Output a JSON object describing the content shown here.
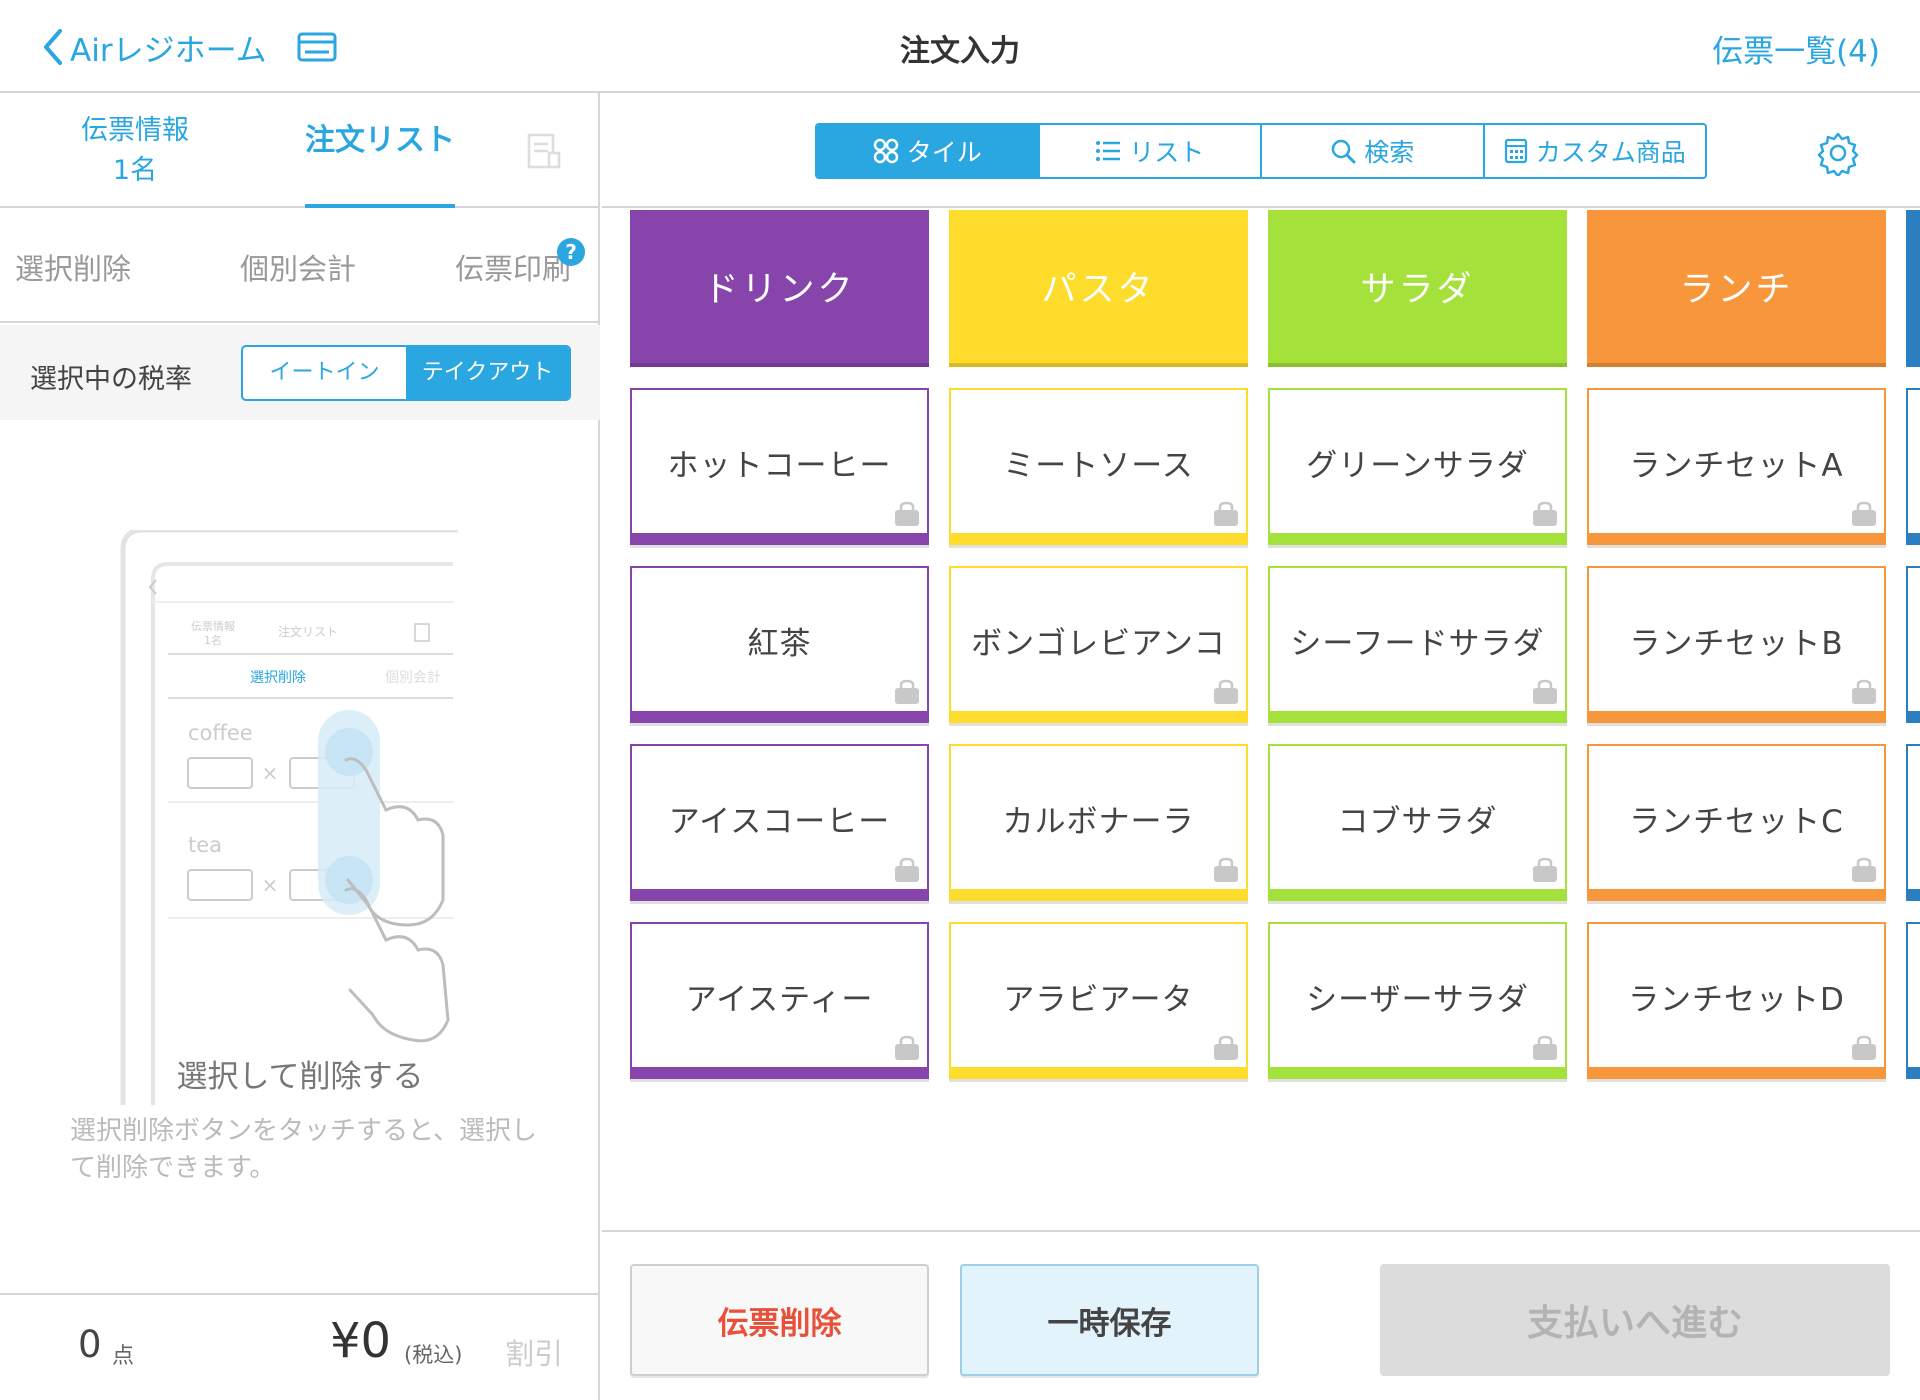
{
  "header": {
    "back_label": "Airレジホーム",
    "title": "注文入力",
    "slip_list_label": "伝票一覧(4)"
  },
  "left_tabs": {
    "info_line1": "伝票情報",
    "info_line2": "1名",
    "order_list": "注文リスト"
  },
  "left_actions": {
    "select_delete": "選択削除",
    "separate_checkout": "個別会計",
    "print_slip": "伝票印刷",
    "help": "?"
  },
  "tax_rate": {
    "label": "選択中の税率",
    "options": [
      "イートイン",
      "テイクアウト"
    ],
    "selected": "テイクアウト"
  },
  "illustration": {
    "tab_info_line1": "伝票情報",
    "tab_info_line2": "1名",
    "tab_order": "注文リスト",
    "action_delete": "選択削除",
    "action_separate": "個別会計",
    "item1": "coffee",
    "item2": "tea",
    "times": "×"
  },
  "empty_state": {
    "title": "選択して削除する",
    "description": "選択削除ボタンをタッチすると、選択して削除できます。"
  },
  "totals": {
    "count": "0",
    "count_unit": "点",
    "price": "¥0",
    "tax_note": "(税込)",
    "discount": "割引"
  },
  "view_modes": {
    "tile": "タイル",
    "list": "リスト",
    "search": "検索",
    "custom": "カスタム商品",
    "active": "tile"
  },
  "colors": {
    "accent": "#2aa6e0",
    "drink": "#8744ab",
    "pasta": "#fddc2b",
    "salad": "#a4e13a",
    "lunch": "#f8963c",
    "delete_text": "#e8503a"
  },
  "categories": [
    {
      "name": "ドリンク",
      "color": "#8744ab",
      "items": [
        "ホットコーヒー",
        "紅茶",
        "アイスコーヒー",
        "アイスティー"
      ]
    },
    {
      "name": "パスタ",
      "color": "#fddc2b",
      "items": [
        "ミートソース",
        "ボンゴレビアンコ",
        "カルボナーラ",
        "アラビアータ"
      ]
    },
    {
      "name": "サラダ",
      "color": "#a4e13a",
      "items": [
        "グリーンサラダ",
        "シーフードサラダ",
        "コブサラダ",
        "シーザーサラダ"
      ]
    },
    {
      "name": "ランチ",
      "color": "#f8963c",
      "items": [
        "ランチセットA",
        "ランチセットB",
        "ランチセットC",
        "ランチセットD"
      ]
    }
  ],
  "footer_buttons": {
    "delete_slip": "伝票削除",
    "hold": "一時保存",
    "proceed_payment": "支払いへ進む"
  }
}
